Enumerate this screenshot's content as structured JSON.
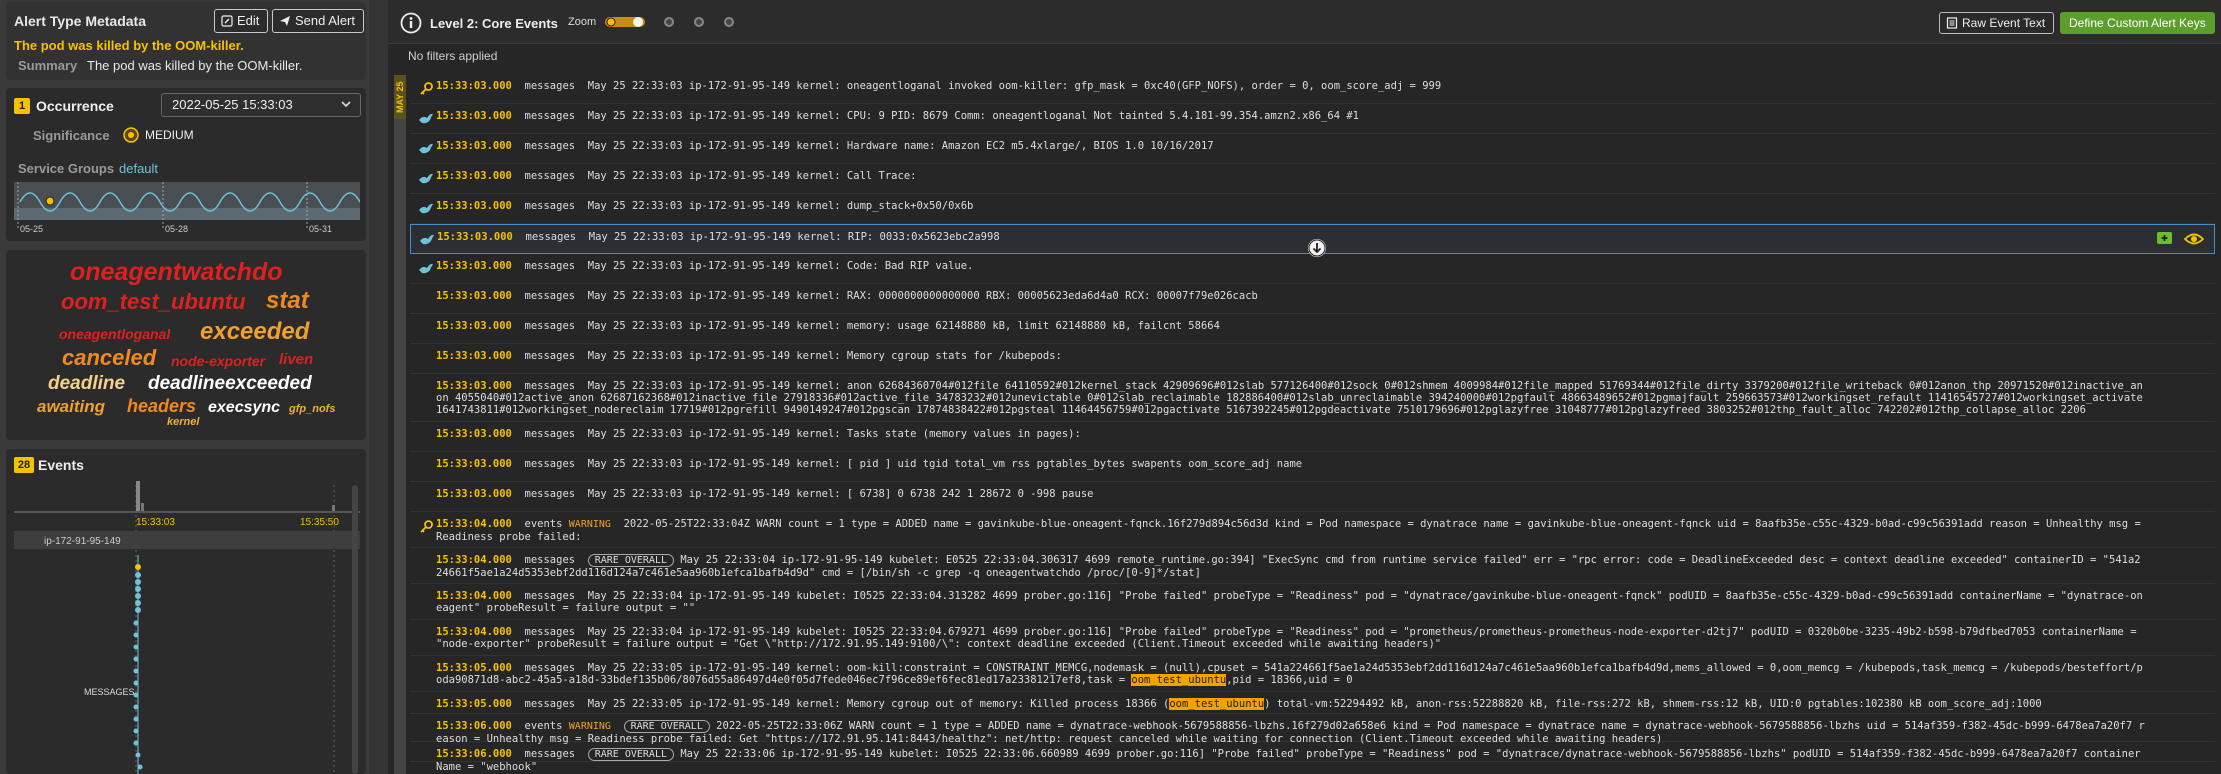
{
  "left": {
    "meta": {
      "title": "Alert Type Metadata",
      "edit_label": "Edit",
      "send_label": "Send Alert",
      "headline": "The pod was killed by the OOM-killer.",
      "summary_label": "Summary",
      "summary": "The pod was killed by the OOM-killer."
    },
    "occurrence": {
      "badge": "1",
      "title": "Occurrence",
      "selected": "2022-05-25 15:33:03",
      "significance_label": "Significance",
      "significance_value": "MEDIUM",
      "service_groups_label": "Service Groups",
      "service_groups_value": "default",
      "timeline_ticks": [
        "05-25",
        "05-28",
        "05-31"
      ]
    },
    "word_cloud": [
      {
        "word": "oneagentwatchdo",
        "color": "#e02020"
      },
      {
        "word": "oom_test_ubuntu",
        "color": "#e02020"
      },
      {
        "word": "stat",
        "color": "#f08a20"
      },
      {
        "word": "oneagentloganal",
        "color": "#e02020"
      },
      {
        "word": "exceeded",
        "color": "#f0a030"
      },
      {
        "word": "canceled",
        "color": "#f08a20"
      },
      {
        "word": "node-exporter",
        "color": "#e02020"
      },
      {
        "word": "liven",
        "color": "#e02020"
      },
      {
        "word": "deadline",
        "color": "#f5d28a"
      },
      {
        "word": "deadlineexceeded",
        "color": "#ffffff"
      },
      {
        "word": "awaiting",
        "color": "#f0a030"
      },
      {
        "word": "headers",
        "color": "#f08a20"
      },
      {
        "word": "execsync",
        "color": "#ffffff"
      },
      {
        "word": "gfp_nofs",
        "color": "#f0b030"
      },
      {
        "word": "kernel",
        "color": "#f0b030"
      }
    ],
    "events": {
      "count": "28",
      "title": "Events",
      "t_start": "15:33:03",
      "t_end": "15:35:50",
      "host": "ip-172-91-95-149",
      "lane": "MESSAGES"
    }
  },
  "right": {
    "title": "Level 2: Core Events",
    "zoom_label": "Zoom",
    "raw_label": "Raw Event Text",
    "define_label": "Define Custom Alert Keys",
    "filters": "No filters applied",
    "date_tag": "MAY 25",
    "rows": [
      {
        "icon": "key",
        "ts": "15:33:03.000",
        "src": "messages",
        "text": "May 25 22:33:03 ip-172-91-95-149 kernel: oneagentloganal invoked oom-killer: gfp_mask = 0xc40(GFP_NOFS), order = 0, oom_score_adj = 999"
      },
      {
        "icon": "bird",
        "ts": "15:33:03.000",
        "src": "messages",
        "text": "May 25 22:33:03 ip-172-91-95-149 kernel: CPU: 9 PID: 8679 Comm: oneagentloganal Not tainted 5.4.181-99.354.amzn2.x86_64 #1"
      },
      {
        "icon": "bird",
        "ts": "15:33:03.000",
        "src": "messages",
        "text": "May 25 22:33:03 ip-172-91-95-149 kernel: Hardware name: Amazon EC2 m5.4xlarge/, BIOS 1.0 10/16/2017"
      },
      {
        "icon": "bird",
        "ts": "15:33:03.000",
        "src": "messages",
        "text": "May 25 22:33:03 ip-172-91-95-149 kernel: Call Trace:"
      },
      {
        "icon": "bird",
        "ts": "15:33:03.000",
        "src": "messages",
        "text": "May 25 22:33:03 ip-172-91-95-149 kernel: dump_stack+0x50/0x6b"
      },
      {
        "icon": "bird",
        "ts": "15:33:03.000",
        "src": "messages",
        "text": "May 25 22:33:03 ip-172-91-95-149 kernel: RIP: 0033:0x5623ebc2a998"
      },
      {
        "icon": "bird",
        "ts": "15:33:03.000",
        "src": "messages",
        "text": "May 25 22:33:03 ip-172-91-95-149 kernel: Code: Bad RIP value."
      },
      {
        "icon": "",
        "ts": "15:33:03.000",
        "src": "messages",
        "text": "May 25 22:33:03 ip-172-91-95-149 kernel: RAX: 0000000000000000 RBX: 00005623eda6d4a0 RCX: 00007f79e026cacb"
      },
      {
        "icon": "",
        "ts": "15:33:03.000",
        "src": "messages",
        "text": "May 25 22:33:03 ip-172-91-95-149 kernel: memory: usage 62148880 kB, limit 62148880 kB, failcnt 58664"
      },
      {
        "icon": "",
        "ts": "15:33:03.000",
        "src": "messages",
        "text": "May 25 22:33:03 ip-172-91-95-149 kernel: Memory cgroup stats for /kubepods:"
      },
      {
        "icon": "",
        "ts": "15:33:03.000",
        "src": "messages",
        "text": "May 25 22:33:03 ip-172-91-95-149 kernel: anon 62684360704#012file 64110592#012kernel_stack 42909696#012slab 577126400#012sock 0#012shmem 4009984#012file_mapped 51769344#012file_dirty 3379200#012file_writeback 0#012anon_thp 20971520#012inactive_anon 4055040#012active_anon 62687162368#012inactive_file 27918336#012active_file 34783232#012unevictable 0#012slab_reclaimable 182886400#012slab_unreclaimable 394240000#012pgfault 48663489652#012pgmajfault 259663573#012workingset_refault 11416545727#012workingset_activate 1641743811#012workingset_nodereclaim 17719#012pgrefill 9490149247#012pgscan 17874838422#012pgsteal 11464456759#012pgactivate 5167392245#012pgdeactivate 7510179696#012pglazyfree 31048777#012pglazyfreed 3803252#012thp_fault_alloc 742202#012thp_collapse_alloc 2206"
      },
      {
        "icon": "",
        "ts": "15:33:03.000",
        "src": "messages",
        "text": "May 25 22:33:03 ip-172-91-95-149 kernel: Tasks state (memory values in pages):"
      },
      {
        "icon": "",
        "ts": "15:33:03.000",
        "src": "messages",
        "text": "May 25 22:33:03 ip-172-91-95-149 kernel: [ pid ] uid tgid total_vm rss pgtables_bytes swapents oom_score_adj name"
      },
      {
        "icon": "",
        "ts": "15:33:03.000",
        "src": "messages",
        "text": "May 25 22:33:03 ip-172-91-95-149 kernel: [ 6738] 0 6738 242 1 28672 0 -998 pause"
      },
      {
        "icon": "key",
        "ts": "15:33:04.000",
        "src": "events",
        "warn": "WARNING",
        "text": "2022-05-25T22:33:04Z WARN count = 1 type = ADDED name = gavinkube-blue-oneagent-fqnck.16f279d894c56d3d kind = Pod namespace = dynatrace name = gavinkube-blue-oneagent-fqnck uid = 8aafb35e-c55c-4329-b0ad-c99c56391add reason = Unhealthy msg = Readiness probe failed:"
      },
      {
        "icon": "",
        "ts": "15:33:04.000",
        "src": "messages",
        "rare": "RARE OVERALL",
        "text": "May 25 22:33:04 ip-172-91-95-149 kubelet: E0525 22:33:04.306317 4699 remote_runtime.go:394] \"ExecSync cmd from runtime service failed\" err = \"rpc error: code = DeadlineExceeded desc = context deadline exceeded\" containerID = \"541a224661f5ae1a24d5353ebf2dd116d124a7c461e5aa960b1efca1bafb4d9d\" cmd = [/bin/sh -c grep -q oneagentwatchdo /proc/[0-9]*/stat]"
      },
      {
        "icon": "",
        "ts": "15:33:04.000",
        "src": "messages",
        "text": "May 25 22:33:04 ip-172-91-95-149 kubelet: I0525 22:33:04.313282 4699 prober.go:116] \"Probe failed\" probeType = \"Readiness\" pod = \"dynatrace/gavinkube-blue-oneagent-fqnck\" podUID = 8aafb35e-c55c-4329-b0ad-c99c56391add containerName = \"dynatrace-oneagent\" probeResult = failure output = \"\""
      },
      {
        "icon": "",
        "ts": "15:33:04.000",
        "src": "messages",
        "text": "May 25 22:33:04 ip-172-91-95-149 kubelet: I0525 22:33:04.679271 4699 prober.go:116] \"Probe failed\" probeType = \"Readiness\" pod = \"prometheus/prometheus-prometheus-node-exporter-d2tj7\" podUID = 0320b0be-3235-49b2-b598-b79dfbed7053 containerName = \"node-exporter\" probeResult = failure output = \"Get \\\"http://172.91.95.149:9100/\\\": context deadline exceeded (Client.Timeout exceeded while awaiting headers)\""
      },
      {
        "icon": "",
        "ts": "15:33:05.000",
        "src": "messages",
        "text": "May 25 22:33:05 ip-172-91-95-149 kernel: oom-kill:constraint = CONSTRAINT_MEMCG,nodemask = (null),cpuset = 541a224661f5ae1a24d5353ebf2dd116d124a7c461e5aa960b1efca1bafb4d9d,mems_allowed = 0,oom_memcg = /kubepods,task_memcg = /kubepods/besteffort/poda90871d8-abc2-45a5-a18d-33bdef135b06/8076d55a86497d4e0f05d7fede046ec7f96ce89ef6fec81ed17a23381217ef8,task = ",
        "hl": "oom_test_ubuntu",
        "text_after": ",pid = 18366,uid = 0"
      },
      {
        "icon": "",
        "ts": "15:33:05.000",
        "src": "messages",
        "text": "May 25 22:33:05 ip-172-91-95-149 kernel: Memory cgroup out of memory: Killed process 18366 (",
        "hl": "oom_test_ubuntu",
        "text_after": ") total-vm:52294492 kB, anon-rss:52288820 kB, file-rss:272 kB, shmem-rss:12 kB, UID:0 pgtables:102380 kB oom_score_adj:1000"
      },
      {
        "icon": "",
        "ts": "15:33:06.000",
        "src": "events",
        "warn": "WARNING",
        "rare": "RARE OVERALL",
        "text": "2022-05-25T22:33:06Z WARN count = 1 type = ADDED name = dynatrace-webhook-5679588856-lbzhs.16f279d02a658e6 kind = Pod namespace = dynatrace name = dynatrace-webhook-5679588856-lbzhs uid = 514af359-f382-45dc-b999-6478ea7a20f7 reason = Unhealthy msg = Readiness probe failed: Get \"https://172.91.95.141:8443/healthz\": net/http: request canceled while waiting for connection (Client.Timeout exceeded while awaiting headers)"
      },
      {
        "icon": "",
        "ts": "15:33:06.000",
        "src": "messages",
        "rare": "RARE OVERALL",
        "text": "May 25 22:33:06 ip-172-91-95-149 kubelet: I0525 22:33:06.660989 4699 prober.go:116] \"Probe failed\" probeType = \"Readiness\" pod = \"dynatrace/dynatrace-webhook-5679588856-lbzhs\" podUID = 514af359-f382-45dc-b999-6478ea7a20f7 containerName = \"webhook\""
      }
    ]
  },
  "colors": {
    "accent": "#f5c200",
    "define_btn": "#5c9e2e",
    "selected_border": "#4a8bc9",
    "highlight": "#f5a200",
    "warning": "#f0a030"
  }
}
